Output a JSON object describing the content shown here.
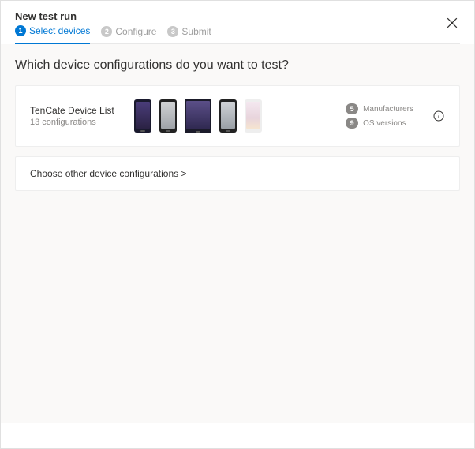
{
  "header": {
    "title": "New test run",
    "steps": [
      {
        "num": "1",
        "label": "Select devices",
        "active": true
      },
      {
        "num": "2",
        "label": "Configure",
        "active": false
      },
      {
        "num": "3",
        "label": "Submit",
        "active": false
      }
    ]
  },
  "content": {
    "question": "Which device configurations do you want to test?",
    "deviceList": {
      "name": "TenCate Device List",
      "count": "13 configurations",
      "stats": {
        "manufacturers": {
          "value": "5",
          "label": "Manufacturers"
        },
        "osVersions": {
          "value": "9",
          "label": "OS versions"
        }
      }
    },
    "chooseOther": "Choose other device configurations >"
  }
}
